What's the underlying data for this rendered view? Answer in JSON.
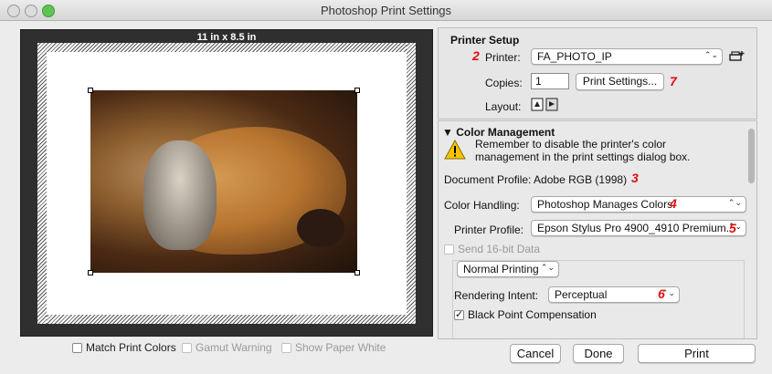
{
  "window": {
    "title": "Photoshop Print Settings"
  },
  "preview": {
    "paper_size": "11 in x 8.5 in"
  },
  "preview_options": {
    "match_print_colors": "Match Print Colors",
    "gamut_warning": "Gamut Warning",
    "show_paper_white": "Show Paper White"
  },
  "printer_setup": {
    "title": "Printer Setup",
    "printer_label": "Printer:",
    "printer_value": "FA_PHOTO_IP",
    "copies_label": "Copies:",
    "copies_value": "1",
    "print_settings_button": "Print Settings...",
    "layout_label": "Layout:"
  },
  "color_management": {
    "title": "Color Management",
    "warning": "Remember to disable the printer's color management in the print settings dialog box.",
    "warning_line1": "Remember to disable the printer's color",
    "warning_line2": "management in the print settings dialog box.",
    "document_profile": "Document Profile: Adobe RGB (1998)",
    "color_handling_label": "Color Handling:",
    "color_handling_value": "Photoshop Manages Colors",
    "printer_profile_label": "Printer Profile:",
    "printer_profile_value": "Epson Stylus Pro 4900_4910 Premium...",
    "send16_label": "Send 16-bit Data",
    "normal_printing_value": "Normal Printing",
    "rendering_intent_label": "Rendering Intent:",
    "rendering_intent_value": "Perceptual",
    "black_point_label": "Black Point Compensation",
    "black_point_checked": true
  },
  "annotations": {
    "n2": "2",
    "n3": "3",
    "n4": "4",
    "n5": "5",
    "n6": "6",
    "n7": "7",
    "color": "#e01010"
  },
  "footer": {
    "cancel": "Cancel",
    "done": "Done",
    "print": "Print"
  },
  "icons": [
    "add-printer-icon",
    "layout-portrait-icon",
    "layout-landscape-icon",
    "warning-icon",
    "disclosure-triangle-icon"
  ]
}
